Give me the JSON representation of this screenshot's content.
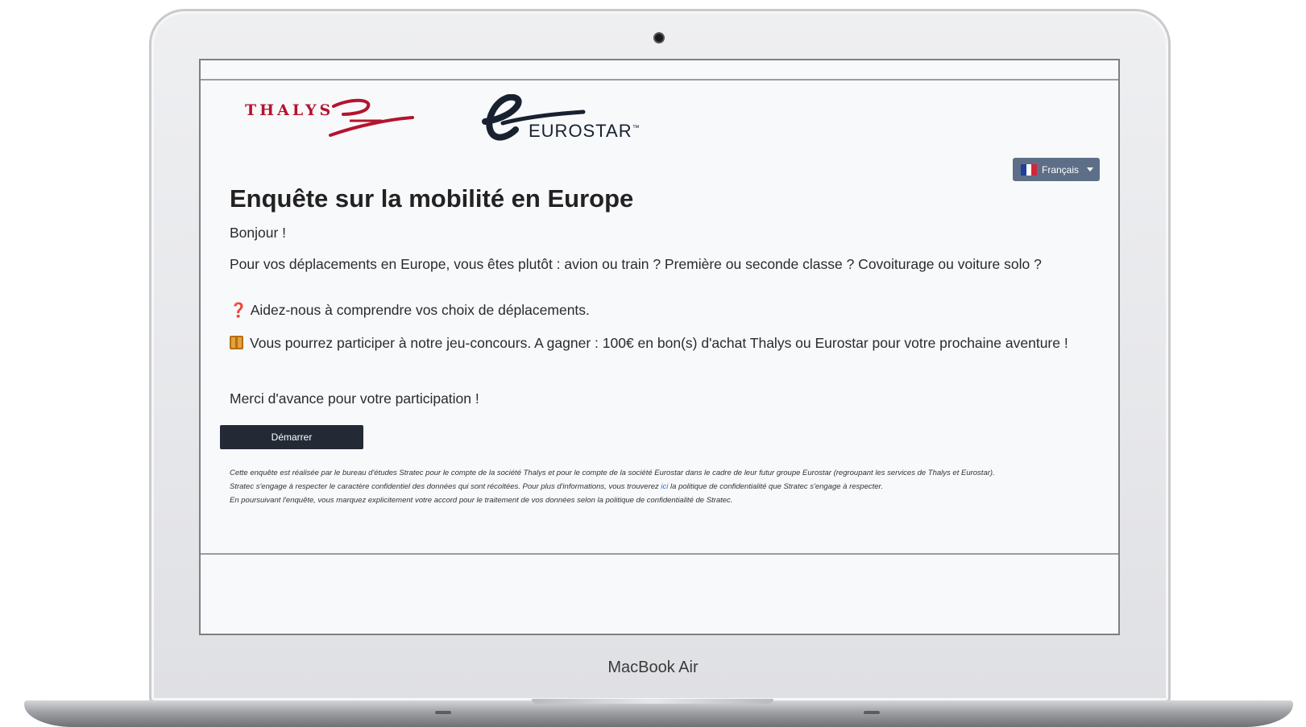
{
  "device": {
    "model_label": "MacBook Air"
  },
  "logos": {
    "thalys": "THALYS",
    "eurostar": "EUROSTAR",
    "eurostar_tm": "™"
  },
  "language_selector": {
    "label": "Français",
    "flag_colors": [
      "#1f3f9a",
      "#ffffff",
      "#d3263a"
    ]
  },
  "survey": {
    "title": "Enquête sur la mobilité en Europe",
    "greeting": "Bonjour !",
    "intro": "Pour vos déplacements en Europe, vous êtes plutôt : avion ou train ? Première ou seconde classe ? Covoiturage ou voiture solo ?",
    "help_icon": "❓",
    "help_text": "Aidez-nous à comprendre vos choix de déplacements.",
    "contest_icon": "gift-icon",
    "contest_text": "Vous pourrez participer à notre jeu-concours. A gagner : 100€ en bon(s) d'achat Thalys ou Eurostar pour votre prochaine aventure !",
    "thanks": "Merci d'avance pour votre participation !",
    "start_button": "Démarrer"
  },
  "legal": {
    "line1": "Cette enquête est réalisée par le bureau d'études Stratec pour le compte de la société Thalys et pour le compte de la société Eurostar dans le cadre de leur futur groupe Eurostar (regroupant les services de Thalys et Eurostar).",
    "line2_before": "Stratec s'engage à respecter le caractère confidentiel des données qui sont récoltées. Pour plus d'informations, vous trouverez",
    "line2_link": "ici",
    "line2_after": "la politique de confidentialité que Stratec s'engage à respecter.",
    "line3": "En poursuivant l'enquête, vous marquez explicitement votre accord pour le traitement de vos données selon la politique de confidentialité de Stratec."
  },
  "colors": {
    "thalys_red": "#b4142e",
    "eurostar_navy": "#18212f",
    "button_dark": "#232a36",
    "lang_button": "#5d6f86"
  }
}
